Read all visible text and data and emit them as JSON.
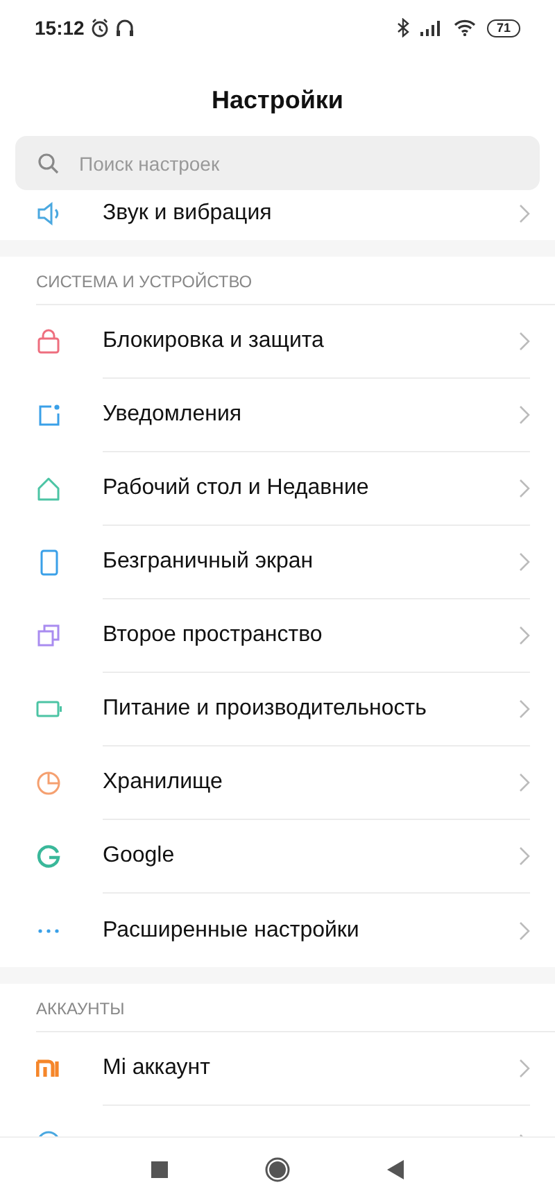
{
  "status_bar": {
    "time": "15:12",
    "battery": "71"
  },
  "title": "Настройки",
  "search": {
    "placeholder": "Поиск настроек"
  },
  "partial_top_item": {
    "label": "Звук и вибрация",
    "kind": "sound",
    "color": "#4aa8e0"
  },
  "sections": [
    {
      "header": "СИСТЕМА И УСТРОЙСТВО",
      "items": [
        {
          "label": "Блокировка и защита",
          "kind": "lock",
          "color": "#ee6e7e"
        },
        {
          "label": "Уведомления",
          "kind": "notify",
          "color": "#3aa0e8"
        },
        {
          "label": "Рабочий стол и Недавние",
          "kind": "home",
          "color": "#4cc4a4"
        },
        {
          "label": "Безграничный экран",
          "kind": "screen",
          "color": "#3aa0e8"
        },
        {
          "label": "Второе пространство",
          "kind": "space",
          "color": "#a98cf0"
        },
        {
          "label": "Питание и производительность",
          "kind": "battery",
          "color": "#4cc4a4"
        },
        {
          "label": "Хранилище",
          "kind": "storage",
          "color": "#f5a070"
        },
        {
          "label": "Google",
          "kind": "google",
          "color": "#3ab89a"
        },
        {
          "label": "Расширенные настройки",
          "kind": "more",
          "color": "#3aa0e8"
        }
      ]
    },
    {
      "header": "АККАУНТЫ",
      "items": [
        {
          "label": "Mi аккаунт",
          "kind": "mi",
          "color": "#f5862a"
        }
      ]
    }
  ],
  "partial_bottom_item": {
    "kind": "circle",
    "color": "#4aa8e0"
  }
}
